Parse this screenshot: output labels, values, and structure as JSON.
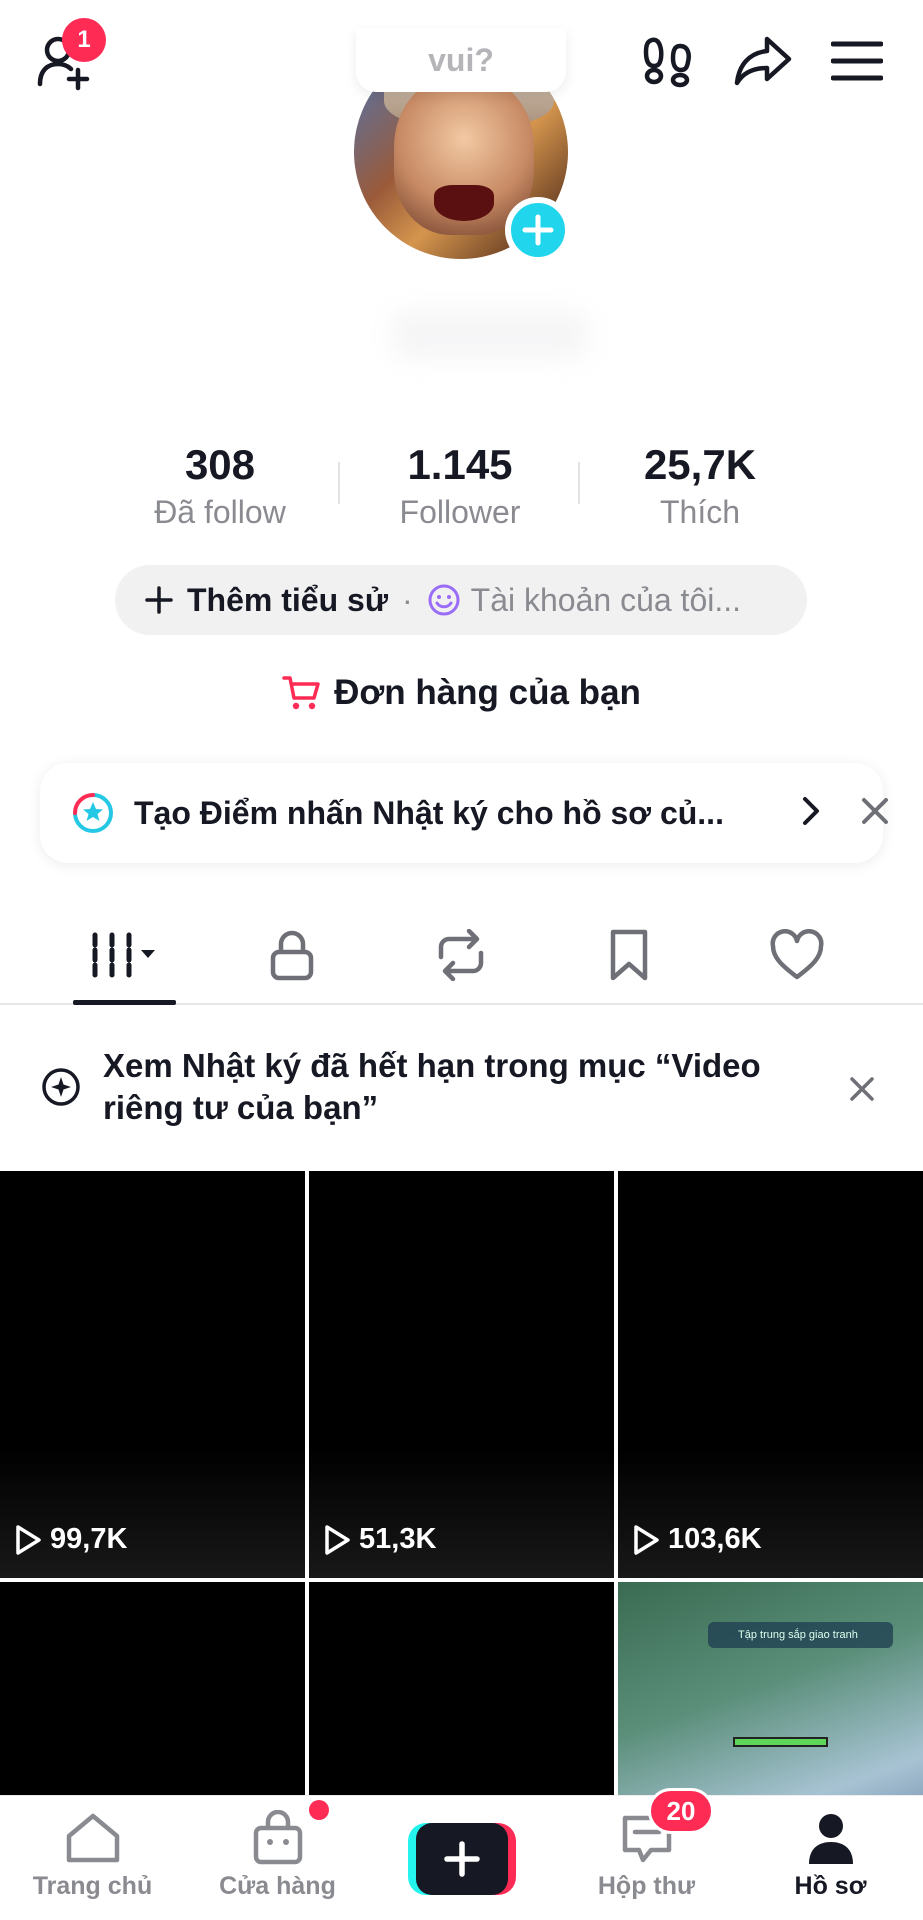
{
  "header": {
    "friends_badge": "1",
    "bubble_text": "vui?"
  },
  "stats": [
    {
      "value": "308",
      "label": "Đã follow"
    },
    {
      "value": "1.145",
      "label": "Follower"
    },
    {
      "value": "25,7K",
      "label": "Thích"
    }
  ],
  "bio": {
    "add_label": "Thêm tiểu sử",
    "separator": "·",
    "account_label": "Tài khoản của tôi..."
  },
  "orders": {
    "label": "Đơn hàng của bạn"
  },
  "highlight": {
    "text": "Tạo Điểm nhấn Nhật ký cho hồ sơ củ..."
  },
  "notice": {
    "text": "Xem Nhật ký đã hết hạn trong mục “Video riêng tư của bạn”"
  },
  "tabs": [
    "videos",
    "private",
    "reposts",
    "favorites",
    "liked"
  ],
  "videos": [
    {
      "views": "99,7K"
    },
    {
      "views": "51,3K"
    },
    {
      "views": "103,6K"
    },
    {
      "views": ""
    },
    {
      "views": ""
    },
    {
      "views": "",
      "overlay_text": "Tập trung sắp giao tranh"
    }
  ],
  "bottom_nav": {
    "home": "Trang chủ",
    "shop": "Cửa hàng",
    "inbox": "Hộp thư",
    "inbox_badge": "20",
    "profile": "Hồ sơ"
  },
  "colors": {
    "accent_red": "#fe2c55",
    "accent_cyan": "#25f4ee",
    "avatar_plus": "#20d5ec",
    "text_primary": "#161823",
    "text_secondary": "#8a8b91"
  }
}
